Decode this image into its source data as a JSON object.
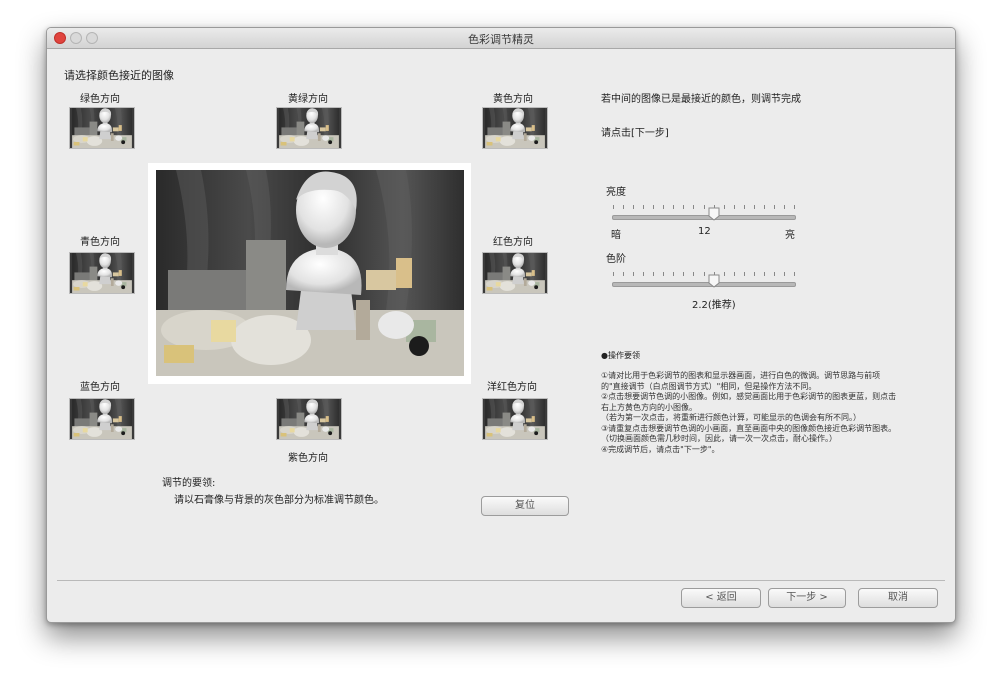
{
  "window": {
    "title": "色彩调节精灵"
  },
  "left": {
    "heading": "请选择颜色接近的图像",
    "thumbs": {
      "green": "绿色方向",
      "yellow_green": "黄绿方向",
      "yellow": "黄色方向",
      "cyan": "青色方向",
      "red": "红色方向",
      "blue": "蓝色方向",
      "purple": "紫色方向",
      "magenta": "洋红色方向"
    },
    "tips_title": "调节的要领:",
    "tips_text": "请以石膏像与背景的灰色部分为标准调节颜色。",
    "reset_label": "复位"
  },
  "right": {
    "hint1": "若中间的图像已是最接近的颜色，则调节完成",
    "hint2": "请点击[下一步]",
    "brightness": {
      "label": "亮度",
      "min_label": "暗",
      "value": "12",
      "max_label": "亮",
      "level": 0.56
    },
    "gamma": {
      "label": "色阶",
      "value": "2.2(推荐)",
      "level": 0.56
    },
    "ops_title": "●操作要领",
    "ops_lines": [
      "①请对比用于色彩调节的图表和显示器画面，进行白色的微调。调节思路与前项",
      "的\"直接调节（白点图调节方式）\"相同，但是操作方法不同。",
      "②点击想要调节色调的小图像。例如，感觉画面比用于色彩调节的图表更蓝，则点击",
      "右上方黄色方向的小图像。",
      "（若为第一次点击，将重新进行颜色计算，可能显示的色调会有所不同。）",
      "③请重复点击想要调节色调的小画面，直至画面中央的图像颜色接近色彩调节图表。",
      "（切换画面颜色需几秒时间，因此，请一次一次点击，耐心操作。）",
      "④完成调节后，请点击\"下一步\"。"
    ]
  },
  "footer": {
    "back_label": "< 返回",
    "next_label": "下一步 >",
    "cancel_label": "取消"
  },
  "colors": {
    "close_button": "#e0443e",
    "window_bg": "#ececec"
  }
}
